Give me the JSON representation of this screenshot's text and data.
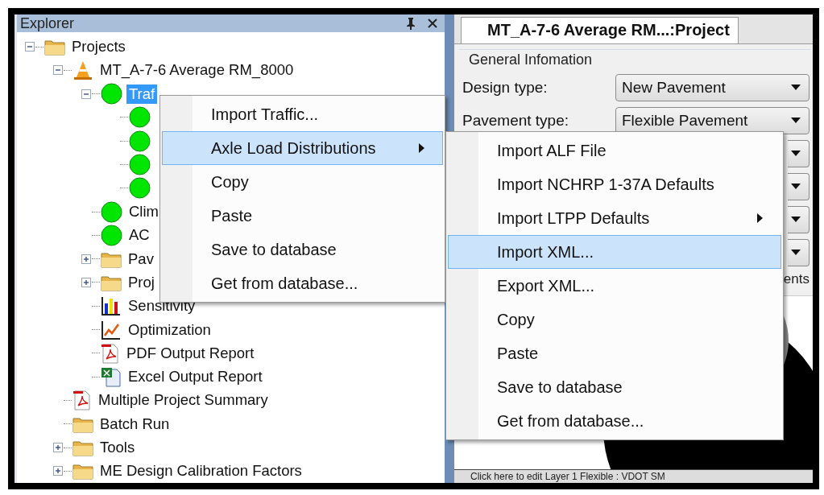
{
  "explorer": {
    "title": "Explorer",
    "tree": [
      {
        "label": "Projects",
        "kind": "folder",
        "selected": false,
        "expanded": true,
        "children": [
          {
            "label": "MT_A-7-6 Average  RM_8000",
            "kind": "project",
            "selected": false,
            "expanded": true,
            "children": [
              {
                "label": "Traf",
                "kind": "status",
                "selected": true,
                "expanded": true,
                "children": [
                  {
                    "kind": "status"
                  },
                  {
                    "kind": "status"
                  },
                  {
                    "kind": "status"
                  },
                  {
                    "kind": "status"
                  }
                ]
              },
              {
                "label": "Clim",
                "kind": "status",
                "selected": false
              },
              {
                "label": "AC",
                "kind": "status",
                "selected": false
              },
              {
                "label": "Pav",
                "kind": "folder",
                "selected": false,
                "expanded": false
              },
              {
                "label": "Proj",
                "kind": "folder",
                "selected": false,
                "expanded": false
              },
              {
                "label": "Sensitivity",
                "kind": "bar_chart",
                "selected": false
              },
              {
                "label": "Optimization",
                "kind": "line_chart",
                "selected": false
              },
              {
                "label": "PDF Output Report",
                "kind": "pdf",
                "selected": false
              },
              {
                "label": "Excel Output Report",
                "kind": "spreadsheet",
                "selected": false
              }
            ]
          },
          {
            "label": "Multiple Project Summary",
            "kind": "pdf",
            "selected": false
          },
          {
            "label": "Batch Run",
            "kind": "folder",
            "selected": false
          },
          {
            "label": "Tools",
            "kind": "folder",
            "selected": false,
            "expanded": false
          },
          {
            "label": "ME Design Calibration Factors",
            "kind": "folder",
            "selected": false,
            "expanded": false
          }
        ]
      }
    ]
  },
  "context_menu": [
    {
      "label": "Import Traffic...",
      "selected": false,
      "submenu": false
    },
    {
      "label": "Axle Load Distributions",
      "selected": true,
      "submenu": true
    },
    {
      "label": "Copy",
      "selected": false,
      "submenu": false
    },
    {
      "label": "Paste",
      "selected": false,
      "submenu": false
    },
    {
      "label": "Save to database",
      "selected": false,
      "submenu": false
    },
    {
      "label": "Get from database...",
      "selected": false,
      "submenu": false
    }
  ],
  "submenu": [
    {
      "label": "Import ALF File",
      "selected": false,
      "submenu": false
    },
    {
      "label": "Import NCHRP 1-37A Defaults",
      "selected": false,
      "submenu": false
    },
    {
      "label": "Import LTPP Defaults",
      "selected": false,
      "submenu": true
    },
    {
      "label": "Import XML...",
      "selected": true,
      "submenu": false
    },
    {
      "label": "Export XML...",
      "selected": false,
      "submenu": false
    },
    {
      "label": "Copy",
      "selected": false,
      "submenu": false
    },
    {
      "label": "Paste",
      "selected": false,
      "submenu": false
    },
    {
      "label": "Save to database",
      "selected": false,
      "submenu": false
    },
    {
      "label": "Get from database...",
      "selected": false,
      "submenu": false
    }
  ],
  "project": {
    "tab": "MT_A-7-6 Average  RM...:Project",
    "group_title": "General Infomation",
    "fields": [
      {
        "label": "Design type:",
        "value": "New Pavement"
      },
      {
        "label": "Pavement type:",
        "value": "Flexible Pavement"
      },
      {
        "kind": "dropdown"
      },
      {
        "kind": "dropdown"
      },
      {
        "kind": "dropdown"
      },
      {
        "kind": "dropdown"
      }
    ],
    "note": "ents",
    "status": "Click here to edit Layer 1 Flexible : VDOT SM"
  }
}
